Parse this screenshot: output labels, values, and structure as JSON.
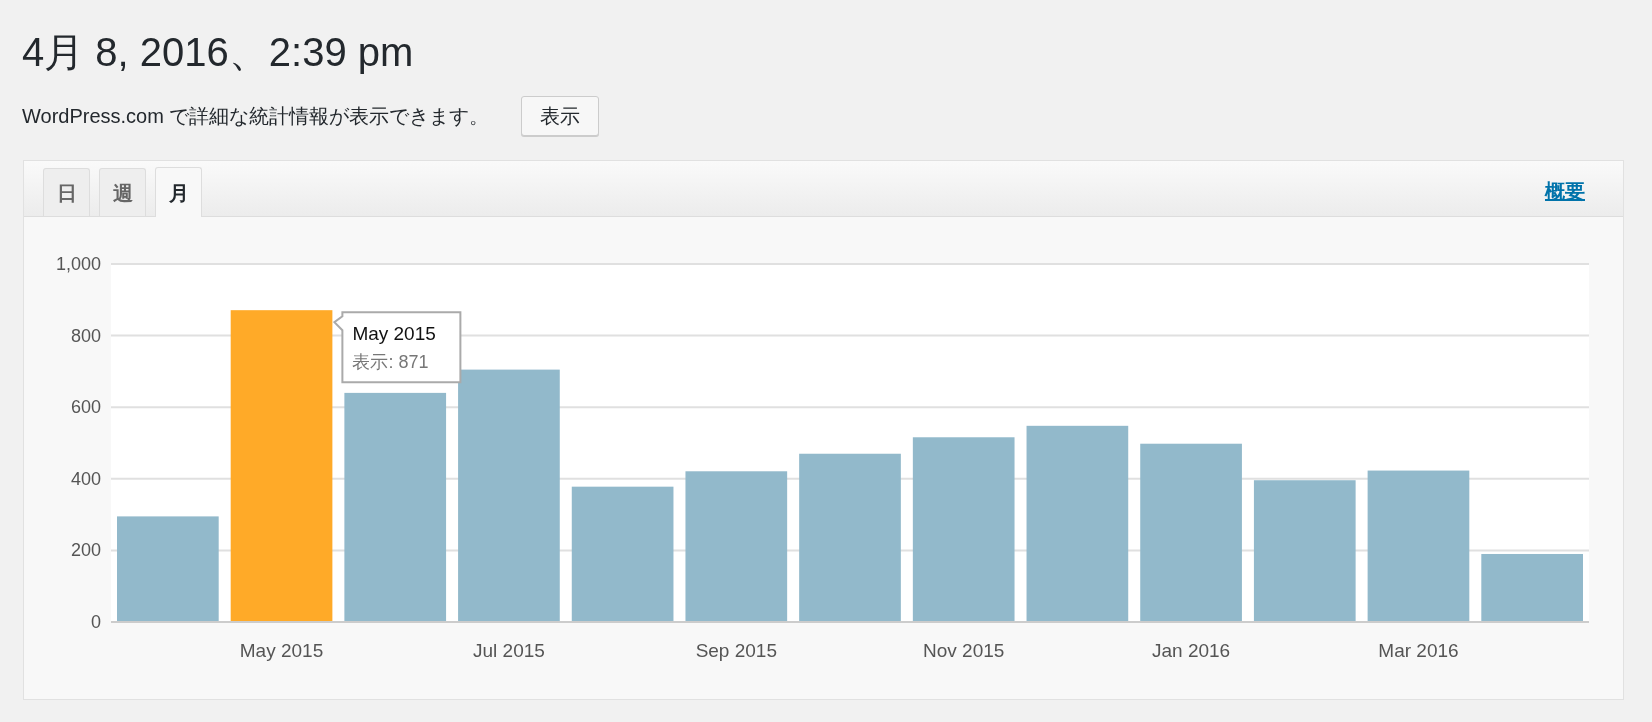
{
  "heading": "4月 8, 2016、2:39 pm",
  "notice": {
    "text": "WordPress.com で詳細な統計情報が表示できます。",
    "button": "表示"
  },
  "tabs": [
    {
      "label": "日",
      "selected": false
    },
    {
      "label": "週",
      "selected": false
    },
    {
      "label": "月",
      "selected": true
    }
  ],
  "summary_link": "概要",
  "chart_data": {
    "type": "bar",
    "ylim": [
      0,
      1000
    ],
    "grid": true,
    "categories": [
      null,
      "May 2015",
      null,
      "Jul 2015",
      null,
      "Sep 2015",
      null,
      "Nov 2015",
      null,
      "Jan 2016",
      null,
      "Mar 2016",
      null
    ],
    "yticks": [
      0,
      200,
      400,
      600,
      800,
      {
        "value": 1000,
        "label": "1,000"
      }
    ],
    "stacked": true,
    "series": [
      {
        "color": "#92b9cb",
        "values": [
          295,
          null,
          640,
          705,
          378,
          421,
          470,
          516,
          548,
          498,
          396,
          423,
          190
        ]
      },
      {
        "color": "#ffaa28",
        "values": [
          null,
          871,
          null,
          null,
          null,
          null,
          null,
          null,
          null,
          null,
          null,
          null,
          null
        ]
      }
    ]
  },
  "tooltip": {
    "title": "May 2015",
    "text": "表示: 871"
  }
}
